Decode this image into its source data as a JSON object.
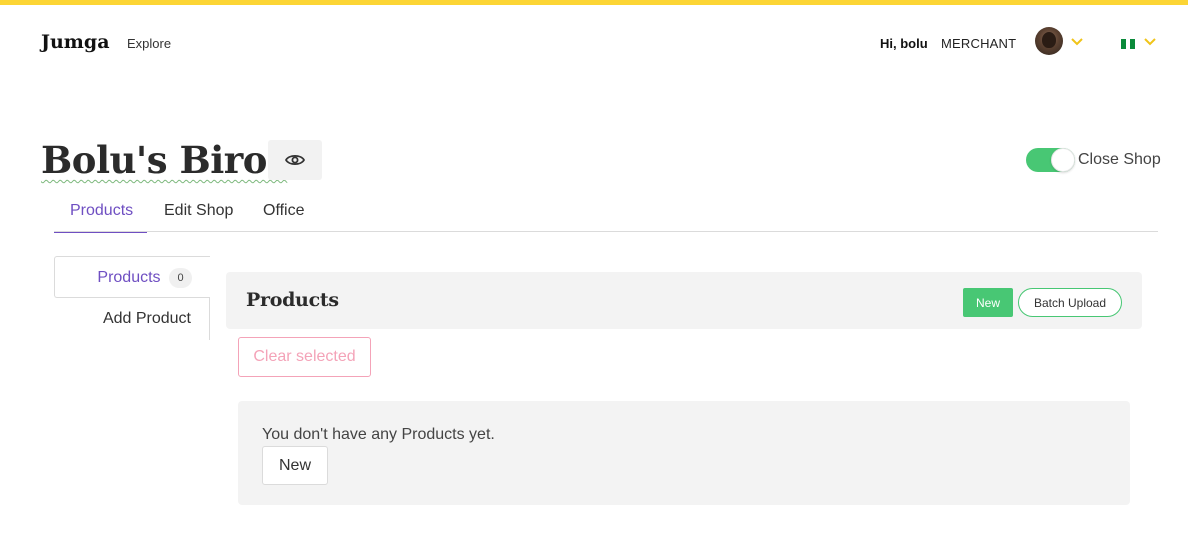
{
  "colors": {
    "accent_bar": "#fcd535",
    "brand_purple": "#6f4fc2",
    "success_green": "#48c774",
    "danger_pink": "#f4a3b8",
    "panel_gray": "#f3f3f3"
  },
  "navbar": {
    "brand": "Jumga",
    "explore_label": "Explore",
    "greeting": "Hi, bolu",
    "role": "MERCHANT",
    "avatar_icon": "user-avatar",
    "chevron_icon": "chevron-down-icon",
    "country_flag": "nigeria-flag"
  },
  "shop": {
    "name": "Bolu's Biros",
    "preview_icon": "eye-icon",
    "toggle_on": true,
    "toggle_label": "Close Shop"
  },
  "tabs": [
    {
      "label": "Products",
      "active": true
    },
    {
      "label": "Edit Shop",
      "active": false
    },
    {
      "label": "Office",
      "active": false
    }
  ],
  "side_menu": {
    "products_label": "Products",
    "products_count": "0",
    "add_product_label": "Add Product"
  },
  "panel": {
    "title": "Products",
    "new_label": "New",
    "batch_upload_label": "Batch Upload",
    "clear_selected_label": "Clear selected",
    "empty_message": "You don't have any Products yet.",
    "empty_new_label": "New"
  }
}
